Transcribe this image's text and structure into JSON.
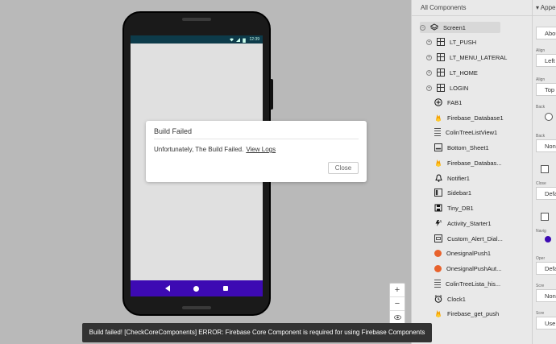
{
  "components_panel": {
    "title": "All Components",
    "items": [
      {
        "label": "Screen1",
        "icon": "screen-stack-icon"
      },
      {
        "label": "LT_PUSH",
        "icon": "table-layout-icon"
      },
      {
        "label": "LT_MENU_LATERAL",
        "icon": "table-layout-icon"
      },
      {
        "label": "LT_HOME",
        "icon": "table-layout-icon"
      },
      {
        "label": "LOGIN",
        "icon": "table-layout-icon"
      },
      {
        "label": "FAB1",
        "icon": "plus-circle-icon"
      },
      {
        "label": "Firebase_Database1",
        "icon": "firebase-icon"
      },
      {
        "label": "ColinTreeListView1",
        "icon": "list-icon"
      },
      {
        "label": "Bottom_Sheet1",
        "icon": "sheet-icon"
      },
      {
        "label": "Firebase_Databas...",
        "icon": "firebase-icon"
      },
      {
        "label": "Notifier1",
        "icon": "bell-icon"
      },
      {
        "label": "Sidebar1",
        "icon": "sidebar-icon"
      },
      {
        "label": "Tiny_DB1",
        "icon": "save-icon"
      },
      {
        "label": "Activity_Starter1",
        "icon": "activity-icon"
      },
      {
        "label": "Custom_Alert_Dial...",
        "icon": "dialog-icon"
      },
      {
        "label": "OnesignalPush1",
        "icon": "onesignal-icon"
      },
      {
        "label": "OnesignalPushAut...",
        "icon": "onesignal-icon"
      },
      {
        "label": "ColinTreeLista_his...",
        "icon": "list-icon"
      },
      {
        "label": "Clock1",
        "icon": "clock-icon"
      },
      {
        "label": "Firebase_get_push",
        "icon": "firebase-icon"
      }
    ]
  },
  "properties_panel": {
    "title": "Appe",
    "labels": [
      "Abou",
      "Align",
      "Left",
      "Align",
      "Top",
      "Back",
      "Back",
      "Non",
      "Close",
      "Defa",
      "Navig",
      "Oper",
      "Defa",
      "Scre",
      "Non",
      "Scre",
      "Use"
    ]
  },
  "phone": {
    "status_time": "12:39"
  },
  "dialog": {
    "title": "Build Failed",
    "message": "Unfortunately, The Build Failed.",
    "link": "View Logs",
    "close_label": "Close"
  },
  "toast": {
    "message": "Build failed! [CheckCoreComponents] ERROR: Firebase Core Component is required for using Firebase Components"
  },
  "zoom": {
    "plus": "+",
    "minus": "−"
  },
  "colors": {
    "status_bar": "#0d3b4a",
    "nav_bar": "#3d0ab3",
    "toast_bg": "#333333"
  }
}
